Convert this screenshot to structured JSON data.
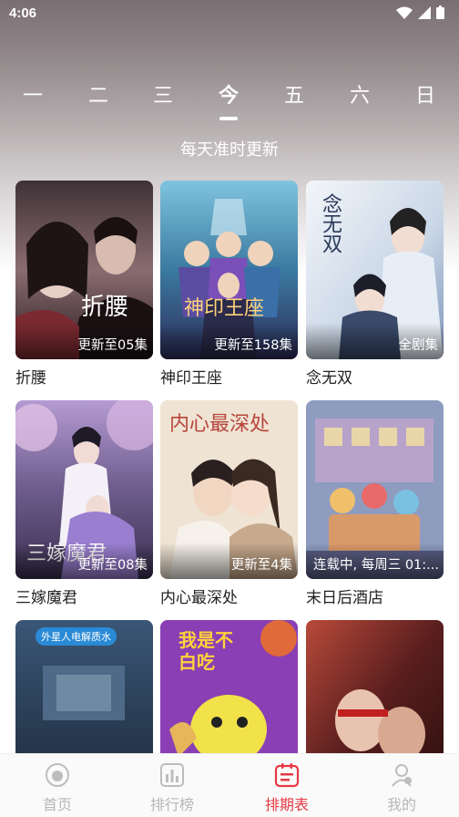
{
  "status_bar": {
    "time": "4:06"
  },
  "days": [
    "一",
    "二",
    "三",
    "今",
    "五",
    "六",
    "日"
  ],
  "active_day_index": 3,
  "subtitle": "每天准时更新",
  "shows": [
    {
      "title": "折腰",
      "badge": "更新至05集",
      "poster_text": "折腰",
      "colors": [
        "#4a3a3c",
        "#a8868a",
        "#2a1e22"
      ]
    },
    {
      "title": "神印王座",
      "badge": "更新至158集",
      "poster_text": "神印王座",
      "colors": [
        "#2e6f8e",
        "#9bd1e0",
        "#3a3a6a"
      ]
    },
    {
      "title": "念无双",
      "badge": "全剧集",
      "poster_text": "念无双",
      "colors": [
        "#c9d6e6",
        "#eef3f8",
        "#8aa3c4"
      ]
    },
    {
      "title": "三嫁魔君",
      "badge": "更新至08集",
      "poster_text": "三嫁魔君",
      "colors": [
        "#6a5a8a",
        "#c8b6e2",
        "#3e3452"
      ]
    },
    {
      "title": "内心最深处",
      "badge": "更新至4集",
      "poster_text": "内心最深处",
      "colors": [
        "#e7d6c2",
        "#f4ece2",
        "#b99a7e"
      ]
    },
    {
      "title": "末日后酒店",
      "badge": "连载中, 每周三 01:...",
      "poster_text": "",
      "colors": [
        "#8e9cc0",
        "#e3c9a4",
        "#5a5f84"
      ]
    },
    {
      "title": "",
      "badge": "",
      "poster_text": "外星人电解质水",
      "colors": [
        "#2f4a66",
        "#6f8ba3",
        "#1c2a3a"
      ]
    },
    {
      "title": "",
      "badge": "",
      "poster_text": "我是不白吃",
      "colors": [
        "#8a3fb4",
        "#f2d23a",
        "#6a2a94"
      ]
    },
    {
      "title": "",
      "badge": "",
      "poster_text": "",
      "colors": [
        "#7a2a2a",
        "#d9a28c",
        "#3a1414"
      ]
    }
  ],
  "tab_bar": {
    "items": [
      {
        "label": "首页",
        "icon": "home-icon"
      },
      {
        "label": "排行榜",
        "icon": "ranking-icon"
      },
      {
        "label": "排期表",
        "icon": "schedule-icon"
      },
      {
        "label": "我的",
        "icon": "profile-icon"
      }
    ],
    "active_index": 2,
    "active_color": "#e63a45",
    "inactive_color": "#b7b7b7"
  }
}
